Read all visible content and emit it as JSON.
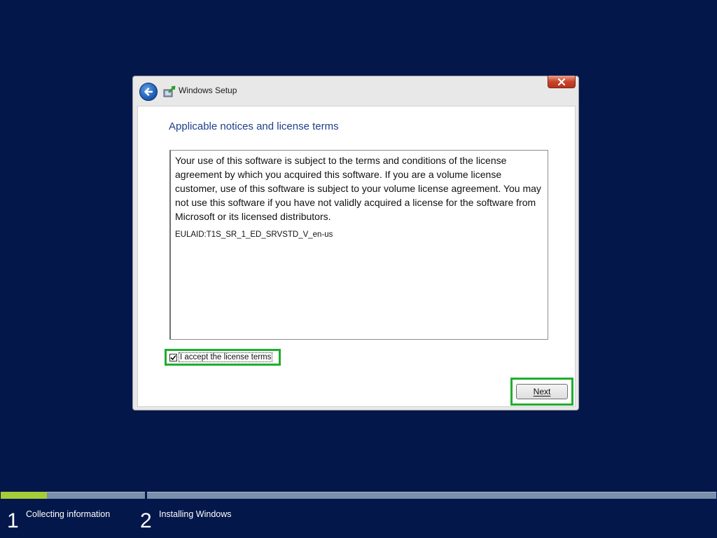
{
  "window": {
    "title": "Windows Setup"
  },
  "page": {
    "heading": "Applicable notices and license terms",
    "license_text": "Your use of this software is subject to the terms and conditions of the license agreement by which you acquired this software.  If you are a volume license customer, use of this software is subject to your volume license agreement.  You may not use this software if you have not validly acquired a license for the software from Microsoft or its licensed distributors.",
    "eula_id": "EULAID:T1S_SR_1_ED_SRVSTD_V_en-us",
    "accept_label": "I accept the license terms",
    "accept_checked": true,
    "next_label": "Next"
  },
  "progress": {
    "fraction": 0.32,
    "steps": [
      {
        "number": "1",
        "label": "Collecting information"
      },
      {
        "number": "2",
        "label": "Installing Windows"
      }
    ]
  },
  "colors": {
    "background": "#03174a",
    "heading": "#1e3f8a",
    "highlight": "#1fae2e",
    "progress_fill": "#a6cc3a",
    "progress_track": "#7990ad"
  },
  "icons": [
    "back-arrow-icon",
    "windows-setup-icon",
    "close-icon",
    "checkmark-icon"
  ]
}
